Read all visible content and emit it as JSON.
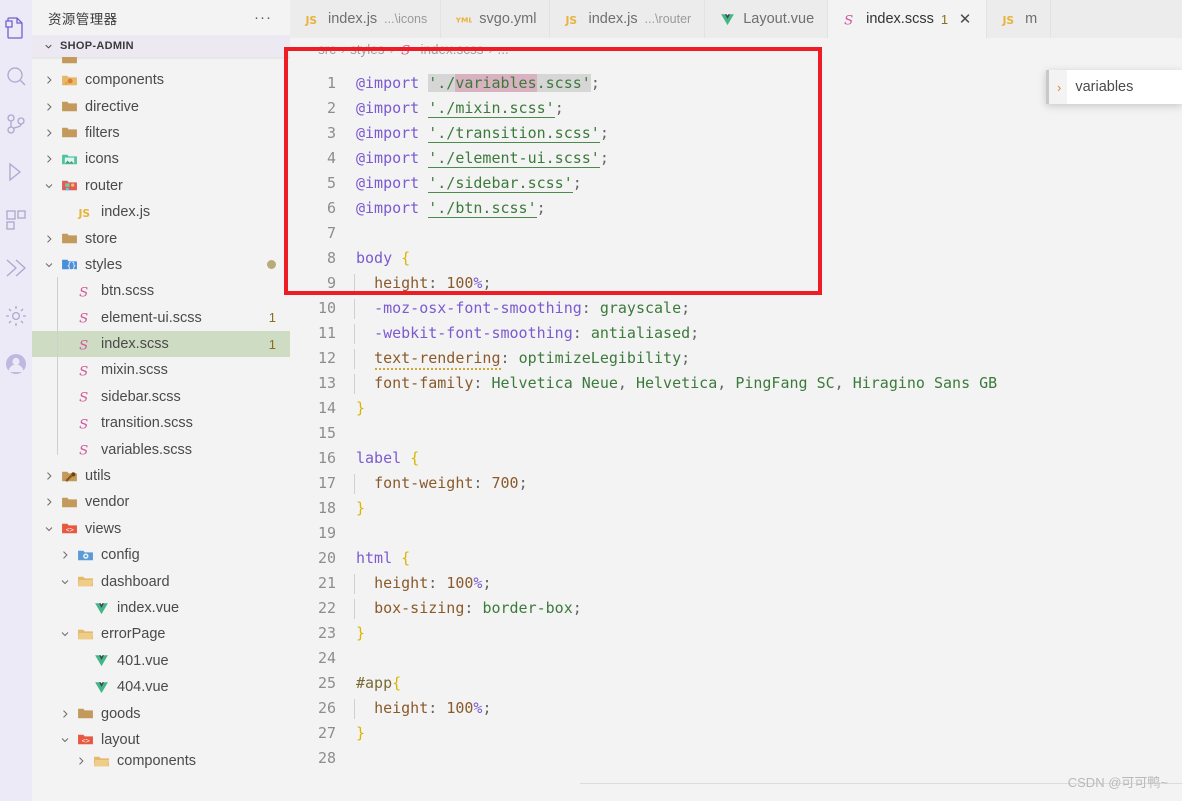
{
  "activitybar": {
    "items": [
      {
        "name": "explorer",
        "icon": "files-icon",
        "active": true
      },
      {
        "name": "search",
        "icon": "search-icon",
        "active": false
      },
      {
        "name": "source-control",
        "icon": "source-control-icon",
        "active": false
      },
      {
        "name": "run-and-debug",
        "icon": "run-debug-icon",
        "active": false
      },
      {
        "name": "extensions",
        "icon": "extensions-icon",
        "active": false
      },
      {
        "name": "vetur",
        "icon": "vetur-icon",
        "active": false
      },
      {
        "name": "settings-sync",
        "icon": "gear-icon",
        "active": false
      },
      {
        "name": "account",
        "icon": "account-icon",
        "active": false
      }
    ]
  },
  "sidebar": {
    "title": "资源管理器",
    "more_actions": "···",
    "section": {
      "label": "SHOP-ADMIN",
      "expanded": true
    },
    "tree": [
      {
        "label": "",
        "icon": "folder-icon",
        "indent": 1,
        "twisty": "",
        "cut": "top"
      },
      {
        "label": "components",
        "icon": "components-folder-icon",
        "indent": 1,
        "twisty": "collapsed"
      },
      {
        "label": "directive",
        "icon": "folder-icon",
        "indent": 1,
        "twisty": "collapsed"
      },
      {
        "label": "filters",
        "icon": "folder-icon",
        "indent": 1,
        "twisty": "collapsed"
      },
      {
        "label": "icons",
        "icon": "images-folder-icon",
        "indent": 1,
        "twisty": "collapsed"
      },
      {
        "label": "router",
        "icon": "router-folder-icon",
        "indent": 1,
        "twisty": "expanded"
      },
      {
        "label": "index.js",
        "icon": "js-icon",
        "indent": 2,
        "twisty": ""
      },
      {
        "label": "store",
        "icon": "folder-icon",
        "indent": 1,
        "twisty": "collapsed"
      },
      {
        "label": "styles",
        "icon": "styles-folder-icon",
        "indent": 1,
        "twisty": "expanded",
        "dirty": true
      },
      {
        "label": "btn.scss",
        "icon": "scss-icon",
        "indent": 2,
        "twisty": ""
      },
      {
        "label": "element-ui.scss",
        "icon": "scss-icon",
        "indent": 2,
        "twisty": "",
        "badge": "1"
      },
      {
        "label": "index.scss",
        "icon": "scss-icon",
        "indent": 2,
        "twisty": "",
        "badge": "1",
        "selected": true
      },
      {
        "label": "mixin.scss",
        "icon": "scss-icon",
        "indent": 2,
        "twisty": ""
      },
      {
        "label": "sidebar.scss",
        "icon": "scss-icon",
        "indent": 2,
        "twisty": ""
      },
      {
        "label": "transition.scss",
        "icon": "scss-icon",
        "indent": 2,
        "twisty": ""
      },
      {
        "label": "variables.scss",
        "icon": "scss-icon",
        "indent": 2,
        "twisty": ""
      },
      {
        "label": "utils",
        "icon": "utils-folder-icon",
        "indent": 1,
        "twisty": "collapsed"
      },
      {
        "label": "vendor",
        "icon": "folder-icon",
        "indent": 1,
        "twisty": "collapsed"
      },
      {
        "label": "views",
        "icon": "views-folder-icon",
        "indent": 1,
        "twisty": "expanded"
      },
      {
        "label": "config",
        "icon": "config-folder-icon",
        "indent": 2,
        "twisty": "collapsed"
      },
      {
        "label": "dashboard",
        "icon": "folder-open-icon",
        "indent": 2,
        "twisty": "expanded"
      },
      {
        "label": "index.vue",
        "icon": "vue-icon",
        "indent": 3,
        "twisty": ""
      },
      {
        "label": "errorPage",
        "icon": "folder-open-icon",
        "indent": 2,
        "twisty": "expanded"
      },
      {
        "label": "401.vue",
        "icon": "vue-icon",
        "indent": 3,
        "twisty": ""
      },
      {
        "label": "404.vue",
        "icon": "vue-icon",
        "indent": 3,
        "twisty": ""
      },
      {
        "label": "goods",
        "icon": "folder-icon",
        "indent": 2,
        "twisty": "collapsed"
      },
      {
        "label": "layout",
        "icon": "views-folder-icon",
        "indent": 2,
        "twisty": "expanded"
      },
      {
        "label": "components",
        "icon": "folder-open-icon",
        "indent": 3,
        "twisty": "collapsed",
        "cut": "bottom"
      }
    ]
  },
  "tabs": [
    {
      "name": "index.js",
      "description": "...\\icons",
      "icon": "js-icon",
      "active": false,
      "badge": "",
      "close": false
    },
    {
      "name": "svgo.yml",
      "description": "",
      "icon": "yaml-icon",
      "active": false,
      "badge": "",
      "close": false
    },
    {
      "name": "index.js",
      "description": "...\\router",
      "icon": "js-icon",
      "active": false,
      "badge": "",
      "close": false
    },
    {
      "name": "Layout.vue",
      "description": "",
      "icon": "vue-icon",
      "active": false,
      "badge": "",
      "close": false
    },
    {
      "name": "index.scss",
      "description": "",
      "icon": "scss-icon",
      "active": true,
      "badge": "1",
      "close": true
    },
    {
      "name": "m",
      "description": "",
      "icon": "js-icon",
      "active": false,
      "badge": "",
      "close": false
    }
  ],
  "breadcrumb": {
    "parts": [
      "src",
      "styles",
      "index.scss",
      "..."
    ],
    "separator": "›",
    "file_icon": "scss-icon"
  },
  "hover_popup": {
    "chevron": "›",
    "label": "variables"
  },
  "editor": {
    "language": "scss",
    "file": "index.scss",
    "first_visible_line": 1,
    "lines": [
      {
        "n": 1,
        "text": "@import './variables.scss';"
      },
      {
        "n": 2,
        "text": "@import './mixin.scss';"
      },
      {
        "n": 3,
        "text": "@import './transition.scss';"
      },
      {
        "n": 4,
        "text": "@import './element-ui.scss';"
      },
      {
        "n": 5,
        "text": "@import './sidebar.scss';"
      },
      {
        "n": 6,
        "text": "@import './btn.scss';"
      },
      {
        "n": 7,
        "text": ""
      },
      {
        "n": 8,
        "text": "body {"
      },
      {
        "n": 9,
        "text": "  height: 100%;"
      },
      {
        "n": 10,
        "text": "  -moz-osx-font-smoothing: grayscale;"
      },
      {
        "n": 11,
        "text": "  -webkit-font-smoothing: antialiased;"
      },
      {
        "n": 12,
        "text": "  text-rendering: optimizeLegibility;"
      },
      {
        "n": 13,
        "text": "  font-family: Helvetica Neue, Helvetica, PingFang SC, Hiragino Sans GB"
      },
      {
        "n": 14,
        "text": "}"
      },
      {
        "n": 15,
        "text": ""
      },
      {
        "n": 16,
        "text": "label {"
      },
      {
        "n": 17,
        "text": "  font-weight: 700;"
      },
      {
        "n": 18,
        "text": "}"
      },
      {
        "n": 19,
        "text": ""
      },
      {
        "n": 20,
        "text": "html {"
      },
      {
        "n": 21,
        "text": "  height: 100%;"
      },
      {
        "n": 22,
        "text": "  box-sizing: border-box;"
      },
      {
        "n": 23,
        "text": "}"
      },
      {
        "n": 24,
        "text": ""
      },
      {
        "n": 25,
        "text": "#app{"
      },
      {
        "n": 26,
        "text": "  height: 100%;"
      },
      {
        "n": 27,
        "text": "}"
      },
      {
        "n": 28,
        "text": ""
      }
    ]
  },
  "annotation": {
    "type": "rectangle",
    "color": "#ee1c24"
  },
  "watermark": "CSDN @可可鸭~",
  "colors": {
    "accent": "#ee1c24",
    "selection": "#cfdcc4",
    "badge": "#8a6d1e",
    "keyword": "#7c5ad0",
    "string": "#3c7a3c",
    "property": "#8a5a2b",
    "brace": "#d9b600"
  }
}
